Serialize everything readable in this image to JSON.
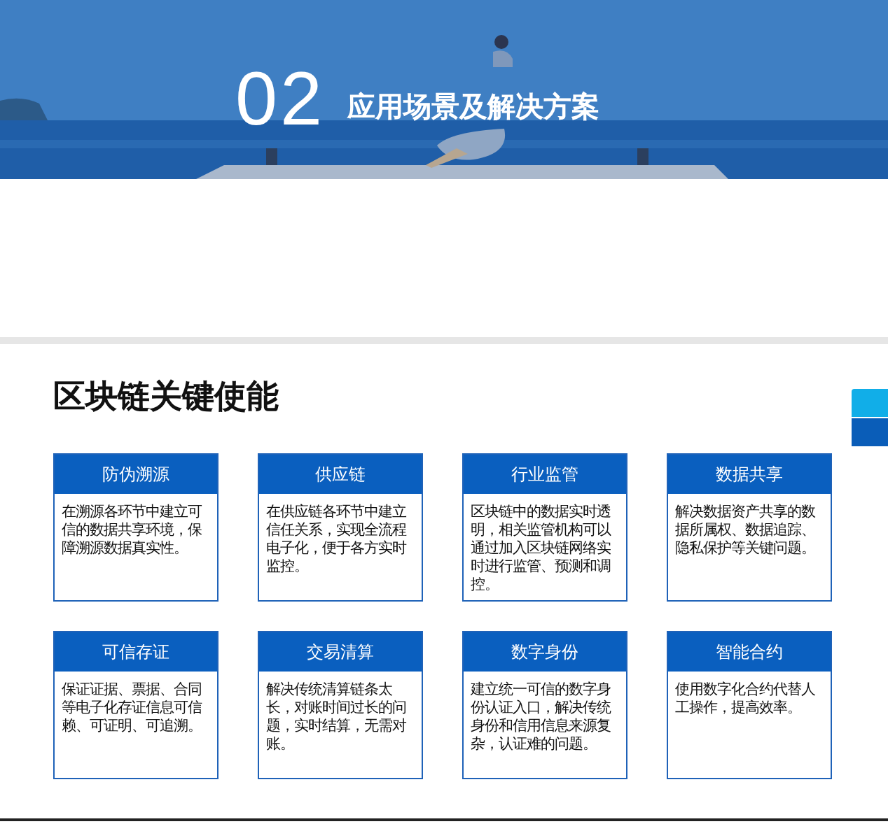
{
  "banner": {
    "kind": "picture",
    "number": "02",
    "title": "应用场景及解决方案"
  },
  "section": {
    "heading": "区块链关键使能",
    "cards": [
      {
        "title": "防伪溯源",
        "body": "在溯源各环节中建立可信的数据共享环境，保障溯源数据真实性。"
      },
      {
        "title": "供应链",
        "body": "在供应链各环节中建立信任关系，实现全流程电子化，便于各方实时监控。"
      },
      {
        "title": "行业监管",
        "body": "区块链中的数据实时透明，相关监管机构可以通过加入区块链网络实时进行监管、预测和调控。"
      },
      {
        "title": "数据共享",
        "body": "解决数据资产共享的数据所属权、数据追踪、隐私保护等关键问题。"
      },
      {
        "title": "可信存证",
        "body": "保证证据、票据、合同等电子化存证信息可信赖、可证明、可追溯。"
      },
      {
        "title": "交易清算",
        "body": "解决传统清算链条太长，对账时间过长的问题，实时结算，无需对账。"
      },
      {
        "title": "数字身份",
        "body": "建立统一可信的数字身份认证入口，解决传统身份和信用信息来源复杂，认证难的问题。"
      },
      {
        "title": "智能合约",
        "body": "使用数字化合约代替人工操作，提高效率。"
      }
    ]
  }
}
